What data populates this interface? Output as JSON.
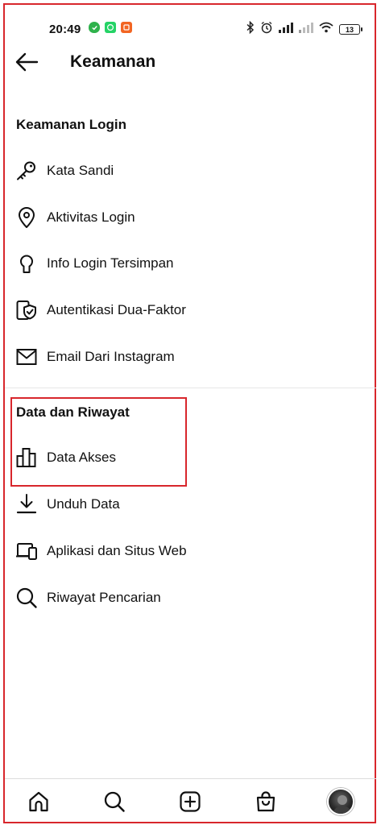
{
  "status_bar": {
    "time": "20:49",
    "battery": "13",
    "app_icon_colors": [
      "#2fb24c",
      "#25d366",
      "#f26522"
    ]
  },
  "header": {
    "title": "Keamanan"
  },
  "sections": [
    {
      "heading": "Keamanan Login",
      "items": [
        {
          "label": "Kata Sandi",
          "icon": "key-icon"
        },
        {
          "label": "Aktivitas Login",
          "icon": "location-pin-icon"
        },
        {
          "label": "Info Login Tersimpan",
          "icon": "keyhole-icon"
        },
        {
          "label": "Autentikasi Dua-Faktor",
          "icon": "shield-check-icon"
        },
        {
          "label": "Email Dari Instagram",
          "icon": "envelope-icon"
        }
      ]
    },
    {
      "heading": "Data dan Riwayat",
      "items": [
        {
          "label": "Data Akses",
          "icon": "bar-chart-icon"
        },
        {
          "label": "Unduh Data",
          "icon": "download-icon"
        },
        {
          "label": "Aplikasi dan Situs Web",
          "icon": "devices-icon"
        },
        {
          "label": "Riwayat Pencarian",
          "icon": "search-icon"
        }
      ]
    }
  ],
  "bottom_nav": [
    "home-icon",
    "search-icon",
    "add-post-icon",
    "shop-icon",
    "profile-avatar"
  ],
  "colors": {
    "highlight": "#d8262c",
    "text": "#111111"
  }
}
